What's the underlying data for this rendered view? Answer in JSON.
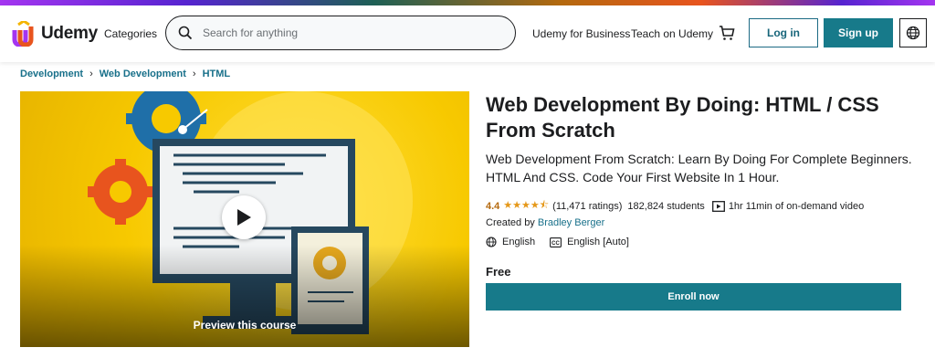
{
  "brand": {
    "name": "Udemy"
  },
  "header": {
    "categories_label": "Categories",
    "search_placeholder": "Search for anything",
    "business_label": "Udemy for Business",
    "teach_label": "Teach on Udemy",
    "login_label": "Log in",
    "signup_label": "Sign up"
  },
  "breadcrumb": [
    "Development",
    "Web Development",
    "HTML"
  ],
  "preview": {
    "label": "Preview this course"
  },
  "course": {
    "title": "Web Development By Doing: HTML / CSS From Scratch",
    "subtitle": "Web Development From Scratch: Learn By Doing For Complete Beginners. HTML And CSS. Code Your First Website In 1 Hour.",
    "rating": "4.4",
    "stars": "★★★★⯪",
    "ratings_count": "(11,471 ratings)",
    "students": "182,824 students",
    "video_length": "1hr 11min of on-demand video",
    "created_by_label": "Created by",
    "instructor": "Bradley Berger",
    "language": "English",
    "captions": "English [Auto]",
    "price": "Free",
    "enroll_label": "Enroll now"
  },
  "colors": {
    "teal": "#177a8a",
    "link": "#18708a",
    "rating": "#b4690e",
    "star": "#e59819",
    "preview_bg": "#f7c900"
  },
  "icons": [
    "search-icon",
    "cart-icon",
    "globe-icon",
    "play-icon",
    "video-icon",
    "language-icon",
    "captions-icon"
  ]
}
